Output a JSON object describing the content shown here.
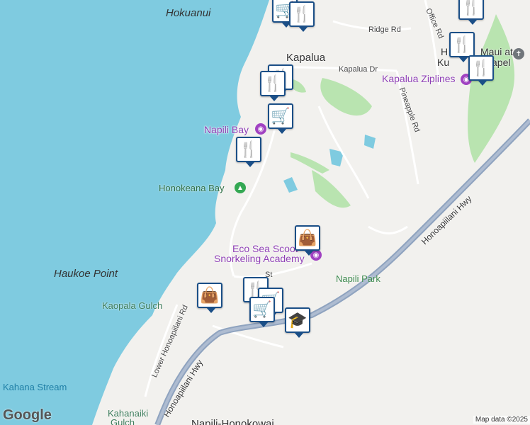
{
  "map": {
    "places": {
      "hokuanui": "Hokuanui",
      "kapalua": "Kapalua",
      "haukoe_point": "Haukoe Point",
      "napili_park": "Napili Park",
      "napili_honokowai": "Napili-Honokowai"
    },
    "water": {
      "honokeana_bay": "Honokeana Bay",
      "kahana_stream": "Kahana Stream"
    },
    "gulches": {
      "kaopala": "Kaopala Gulch",
      "kahanaiki_line1": "Kahanaiki",
      "kahanaiki_line2": "Gulch"
    },
    "pois": {
      "napili_bay": "Napili Bay",
      "kapalua_ziplines": "Kapalua Ziplines",
      "eco_sea_line1": "Eco Sea Scoot",
      "eco_sea_line2": "Snorkeling Academy",
      "kapalua_hotel_line1": "H",
      "kapalua_hotel_maui": "Maui at",
      "kapalua_hotel_kum": "Ku",
      "kapalua_hotel_apel": "apel"
    },
    "roads": {
      "ridge": "Ridge Rd",
      "office": "Office Rd",
      "kapalua_dr": "Kapalua Dr",
      "pineapple": "Pineapple Rd",
      "lower_honoapiilani": "Lower Honoapiilani Rd",
      "hwy_east": "Honoapiilani Hwy",
      "hwy_west": "Honoapiilani Hwy",
      "st": "St"
    },
    "colors": {
      "water": "#7fcbe0",
      "land": "#f2f1ee",
      "park": "#b9e4b0",
      "highway": "#8fa3bf",
      "pin_border": "#1b4f87"
    },
    "pins": [
      {
        "icon": "shopping-cart-icon",
        "glyph": "🛒"
      },
      {
        "icon": "fork-knife-icon",
        "glyph": "🍴"
      },
      {
        "icon": "fork-knife-icon",
        "glyph": "🍴"
      },
      {
        "icon": "fork-knife-icon",
        "glyph": "🍴"
      },
      {
        "icon": "fork-knife-icon",
        "glyph": "🍴"
      },
      {
        "icon": "fork-knife-icon",
        "glyph": "🍴"
      },
      {
        "icon": "fork-knife-icon",
        "glyph": "🍴"
      },
      {
        "icon": "shopping-cart-icon",
        "glyph": "🛒"
      },
      {
        "icon": "fork-knife-icon",
        "glyph": "🍴"
      },
      {
        "icon": "shopping-bag-icon",
        "glyph": "👜"
      },
      {
        "icon": "shopping-bag-icon",
        "glyph": "👜"
      },
      {
        "icon": "fork-knife-icon",
        "glyph": "🍴"
      },
      {
        "icon": "shopping-cart-icon",
        "glyph": "🛒"
      },
      {
        "icon": "shopping-cart-icon",
        "glyph": "🛒"
      },
      {
        "icon": "graduation-cap-icon",
        "glyph": "🎓"
      }
    ],
    "branding": "Google",
    "attribution": "Map data ©2025"
  }
}
